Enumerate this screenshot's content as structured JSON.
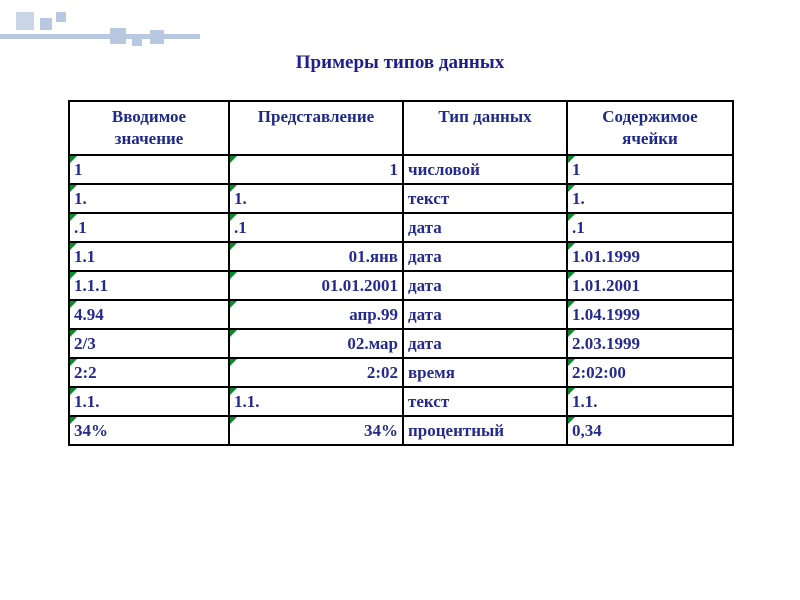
{
  "title": "Примеры типов данных",
  "headers": {
    "col1_line1": "Вводимое",
    "col1_line2": "значение",
    "col2": "Представление",
    "col3": "Тип данных",
    "col4_line1": "Содержимое",
    "col4_line2": "ячейки"
  },
  "rows": [
    {
      "input": "1",
      "repr": "1",
      "repr_align": "right",
      "type": "числовой",
      "content": "1"
    },
    {
      "input": "1.",
      "repr": "1.",
      "repr_align": "left",
      "type": "текст",
      "content": "1."
    },
    {
      "input": ".1",
      "repr": ".1",
      "repr_align": "left",
      "type": "дата",
      "content": ".1"
    },
    {
      "input": "1.1",
      "repr": "01.янв",
      "repr_align": "right",
      "type": "дата",
      "content": "1.01.1999"
    },
    {
      "input": "1.1.1",
      "repr": "01.01.2001",
      "repr_align": "right",
      "type": "дата",
      "content": "1.01.2001"
    },
    {
      "input": "4.94",
      "repr": "апр.99",
      "repr_align": "right",
      "type": "дата",
      "content": "1.04.1999"
    },
    {
      "input": "2/3",
      "repr": "02.мар",
      "repr_align": "right",
      "type": "дата",
      "content": "2.03.1999"
    },
    {
      "input": "2:2",
      "repr": "2:02",
      "repr_align": "right",
      "type": "время",
      "content": "2:02:00"
    },
    {
      "input": "1.1.",
      "repr": "1.1.",
      "repr_align": "left",
      "type": "текст",
      "content": "1.1."
    },
    {
      "input": "34%",
      "repr": "34%",
      "repr_align": "right",
      "type": "процентный",
      "content": "0,34"
    }
  ]
}
